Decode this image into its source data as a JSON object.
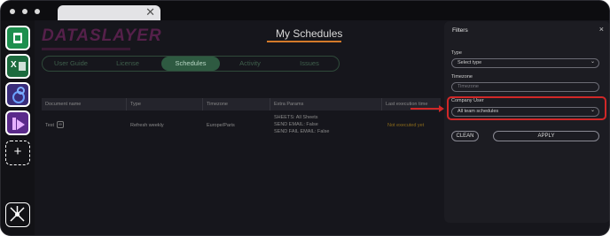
{
  "app": {
    "logo_text": "DATASLAYER",
    "page_title": "My Schedules"
  },
  "nav_tabs": [
    {
      "label": "User Guide"
    },
    {
      "label": "License"
    },
    {
      "label": "Schedules",
      "active": true
    },
    {
      "label": "Activity"
    },
    {
      "label": "Issues"
    }
  ],
  "sidebar": {
    "items": [
      {
        "icon": "google-sheets-icon"
      },
      {
        "icon": "excel-icon"
      },
      {
        "icon": "looker-studio-icon"
      },
      {
        "icon": "power-bi-icon"
      },
      {
        "icon": "add-icon",
        "label": "+"
      },
      {
        "icon": "hub-icon"
      }
    ]
  },
  "table": {
    "headers": [
      "Document name",
      "Type",
      "Timezone",
      "Extra Params",
      "Last execution time"
    ],
    "rows": [
      {
        "document_name": "Test",
        "type": "Refresh weekly",
        "timezone": "Europe/Paris",
        "extra_params": [
          "SHEETS: All Sheets",
          "SEND EMAIL: False",
          "SEND FAIL EMAIL: False"
        ],
        "last_execution": "Not executed yet"
      }
    ]
  },
  "filters": {
    "title": "Filters",
    "close": "×",
    "type_label": "Type",
    "type_value": "Select type",
    "timezone_label": "Timezone",
    "timezone_placeholder": "Timezone",
    "company_user_label": "Company User",
    "company_user_value": "All team schedules",
    "clean_label": "CLEAN",
    "apply_label": "APPLY"
  },
  "colors": {
    "accent_active_tab": "#2e5a41",
    "highlight": "#d02828",
    "title_underline": "#d47a2a",
    "last_execution_text": "#8a6a1a"
  }
}
